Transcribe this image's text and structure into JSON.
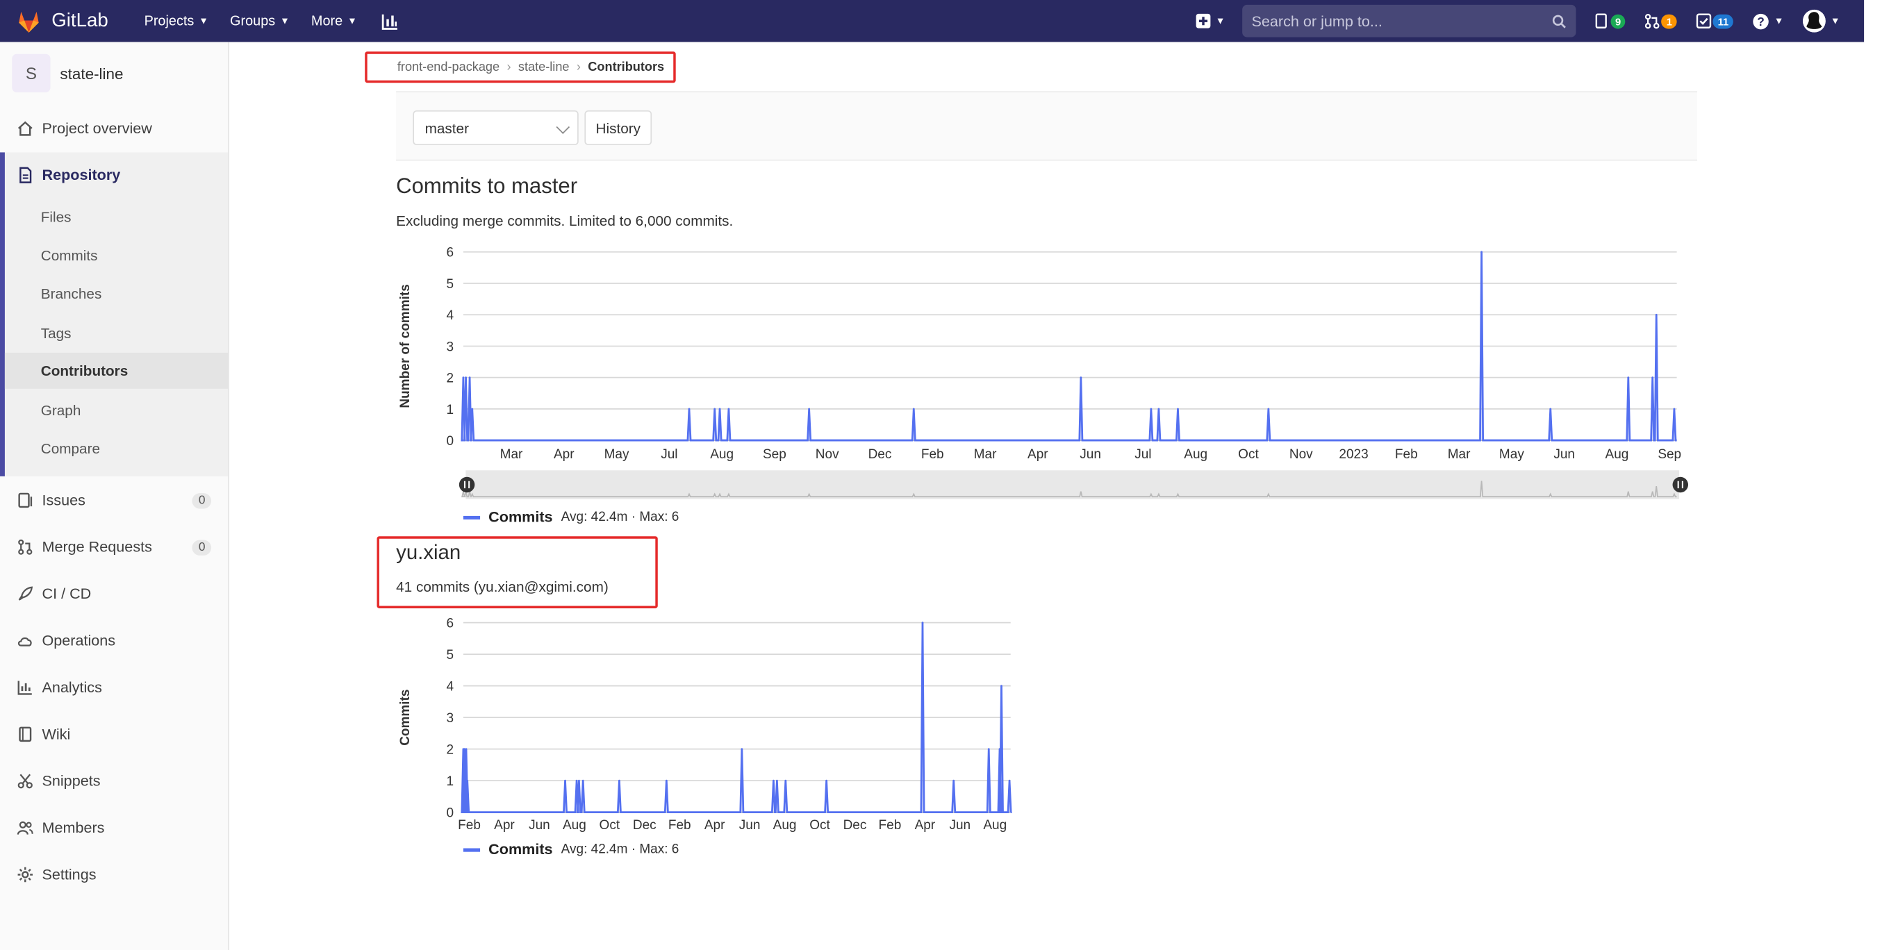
{
  "navbar": {
    "app_name": "GitLab",
    "menu": [
      "Projects",
      "Groups",
      "More"
    ],
    "search_placeholder": "Search or jump to...",
    "issues_count": "9",
    "merge_requests_count": "1",
    "todos_count": "11",
    "colors": {
      "bg": "#292961",
      "issues_badge": "#1aaa55",
      "mr_badge": "#fc9403",
      "todos_badge": "#1f78d1"
    }
  },
  "sidebar": {
    "project_initial": "S",
    "project_name": "state-line",
    "items": [
      {
        "label": "Project overview",
        "icon": "home-icon"
      },
      {
        "label": "Repository",
        "icon": "document-icon"
      },
      {
        "label": "Issues",
        "icon": "issues-icon",
        "count": "0"
      },
      {
        "label": "Merge Requests",
        "icon": "merge-request-icon",
        "count": "0"
      },
      {
        "label": "CI / CD",
        "icon": "rocket-icon"
      },
      {
        "label": "Operations",
        "icon": "cloud-gear-icon"
      },
      {
        "label": "Analytics",
        "icon": "chart-icon"
      },
      {
        "label": "Wiki",
        "icon": "book-icon"
      },
      {
        "label": "Snippets",
        "icon": "scissors-icon"
      },
      {
        "label": "Members",
        "icon": "users-icon"
      },
      {
        "label": "Settings",
        "icon": "gear-icon"
      }
    ],
    "repository_sub": [
      "Files",
      "Commits",
      "Branches",
      "Tags",
      "Contributors",
      "Graph",
      "Compare"
    ],
    "active_sub": "Contributors"
  },
  "breadcrumb": [
    "front-end-package",
    "state-line",
    "Contributors"
  ],
  "toolbar": {
    "branch": "master",
    "history_label": "History"
  },
  "main": {
    "title": "Commits to master",
    "subtitle": "Excluding merge commits. Limited to 6,000 commits."
  },
  "contributor": {
    "name": "yu.xian",
    "summary": "41 commits (yu.xian@xgimi.com)"
  },
  "chart_data": [
    {
      "type": "area",
      "ylabel": "Number of commits",
      "ylim": [
        0,
        6
      ],
      "yticks": [
        0,
        1,
        2,
        3,
        4,
        5,
        6
      ],
      "xticks": [
        "Mar",
        "Apr",
        "May",
        "Jul",
        "Aug",
        "Sep",
        "Nov",
        "Dec",
        "Feb",
        "Mar",
        "Apr",
        "Jun",
        "Jul",
        "Aug",
        "Oct",
        "Nov",
        "2023",
        "Feb",
        "Mar",
        "May",
        "Jun",
        "Aug",
        "Sep"
      ],
      "xrange": [
        "2021-02-01",
        "2023-09-10"
      ],
      "series": [
        {
          "name": "Commits",
          "color": "#5470f0",
          "points": [
            [
              "2021-02-01",
              2
            ],
            [
              "2021-02-03",
              2
            ],
            [
              "2021-02-06",
              2
            ],
            [
              "2021-02-08",
              1
            ],
            [
              "2021-07-28",
              1
            ],
            [
              "2021-08-17",
              1
            ],
            [
              "2021-08-21",
              1
            ],
            [
              "2021-08-28",
              1
            ],
            [
              "2021-10-30",
              1
            ],
            [
              "2022-01-20",
              1
            ],
            [
              "2022-05-31",
              2
            ],
            [
              "2022-07-25",
              1
            ],
            [
              "2022-07-31",
              1
            ],
            [
              "2022-08-15",
              1
            ],
            [
              "2022-10-25",
              1
            ],
            [
              "2023-04-10",
              6
            ],
            [
              "2023-06-03",
              1
            ],
            [
              "2023-08-03",
              2
            ],
            [
              "2023-08-22",
              2
            ],
            [
              "2023-08-25",
              4
            ],
            [
              "2023-09-08",
              1
            ]
          ]
        }
      ],
      "legend": {
        "name": "Commits",
        "stats": "Avg: 42.4m · Max: 6"
      }
    },
    {
      "type": "area",
      "ylabel": "Commits",
      "ylim": [
        0,
        6
      ],
      "yticks": [
        0,
        1,
        2,
        3,
        4,
        5,
        6
      ],
      "xticks": [
        "Feb",
        "Apr",
        "Jun",
        "Aug",
        "Oct",
        "Dec",
        "Feb",
        "Apr",
        "Jun",
        "Aug",
        "Oct",
        "Dec",
        "Feb",
        "Apr",
        "Jun",
        "Aug"
      ],
      "xrange": [
        "2021-02-01",
        "2023-09-10"
      ],
      "series": [
        {
          "name": "Commits",
          "color": "#5470f0",
          "points": [
            [
              "2021-02-01",
              2
            ],
            [
              "2021-02-03",
              2
            ],
            [
              "2021-02-06",
              2
            ],
            [
              "2021-02-08",
              1
            ],
            [
              "2021-07-28",
              1
            ],
            [
              "2021-08-17",
              1
            ],
            [
              "2021-08-21",
              1
            ],
            [
              "2021-08-28",
              1
            ],
            [
              "2021-10-30",
              1
            ],
            [
              "2022-01-20",
              1
            ],
            [
              "2022-05-31",
              2
            ],
            [
              "2022-07-25",
              1
            ],
            [
              "2022-07-31",
              1
            ],
            [
              "2022-08-15",
              1
            ],
            [
              "2022-10-25",
              1
            ],
            [
              "2023-04-10",
              6
            ],
            [
              "2023-06-03",
              1
            ],
            [
              "2023-08-03",
              2
            ],
            [
              "2023-08-22",
              2
            ],
            [
              "2023-08-25",
              4
            ],
            [
              "2023-09-08",
              1
            ]
          ]
        }
      ],
      "legend": {
        "name": "Commits",
        "stats": "Avg: 42.4m · Max: 6"
      }
    }
  ]
}
